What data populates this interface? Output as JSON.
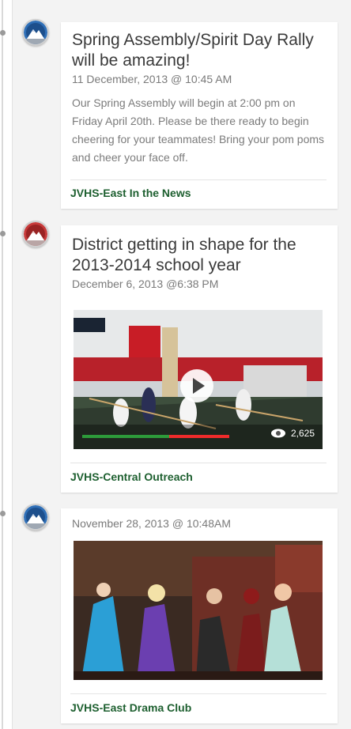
{
  "colors": {
    "footer_text": "#1d5f2f",
    "progress_watched": "#2d9a3a",
    "progress_remaining": "#ef2b2b",
    "title_text": "#3a3a3a"
  },
  "feed": [
    {
      "avatar": "mountain-logo-blue",
      "title": "Spring Assembly/Spirit Day Rally will be amazing!",
      "date": "11 December, 2013 @ 10:45 AM",
      "body": "Our Spring Assembly will begin at 2:00 pm on Friday April 20th. Please be there ready to begin cheering for your teammates! Bring your pom poms and cheer your face off.",
      "footer": "JVHS-East In the News"
    },
    {
      "avatar": "mountain-logo-red",
      "title": "District getting in shape for the 2013-2014 school year",
      "date": "December 6, 2013 @6:38 PM",
      "video": {
        "progress": 0.59,
        "views": "2,625",
        "icons": [
          "play-icon",
          "eye-icon"
        ]
      },
      "footer": "JVHS-Central Outreach"
    },
    {
      "avatar": "mountain-logo-blue",
      "date": "November 28, 2013 @ 10:48AM",
      "footer": "JVHS-East Drama Club"
    }
  ]
}
